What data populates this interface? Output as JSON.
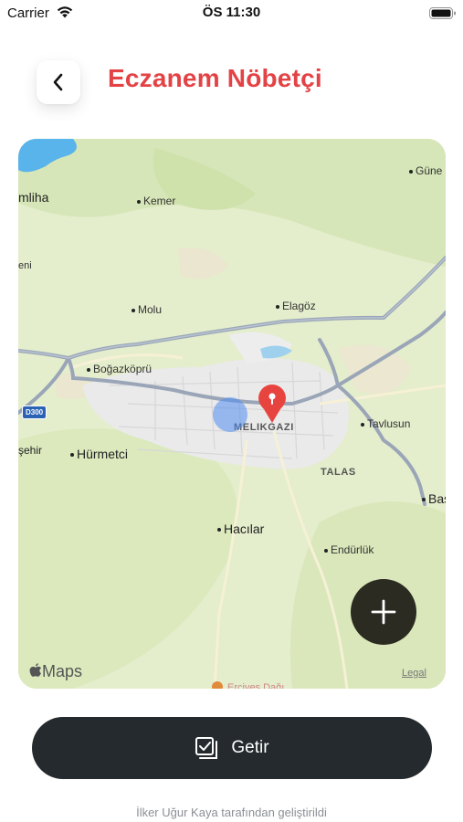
{
  "status_bar": {
    "carrier": "Carrier",
    "time": "ÖS 11:30",
    "wifi_icon": "wifi-icon",
    "battery_icon": "battery-icon"
  },
  "header": {
    "back_icon": "chevron-left-icon",
    "title": "Eczanem Nöbetçi",
    "title_color": "#e44346"
  },
  "map": {
    "places": {
      "gune": "Güne",
      "kemer": "Kemer",
      "mliha": "mliha",
      "eni": "eni",
      "molu": "Molu",
      "elagoz": "Elagöz",
      "bogazkopru": "Boğazköprü",
      "melikgazi": "MELIKGAZI",
      "tavlusun": "Tavlusun",
      "sehir": "şehir",
      "hurmetci": "Hürmetci",
      "talas": "TALAS",
      "bas": "Bas",
      "hacilar": "Hacılar",
      "endurluk": "Endürlük"
    },
    "road_shield": "D300",
    "attribution": "Maps",
    "legal": "Legal",
    "add_icon": "plus-icon",
    "pin_icon": "map-pin-icon",
    "pin_color": "#e8443f",
    "user_location_color": "#5a8ef0"
  },
  "actions": {
    "getir_label": "Getir",
    "getir_icon": "checklist-icon"
  },
  "footer": {
    "credit": "İlker Uğur Kaya tarafından geliştirildi"
  }
}
